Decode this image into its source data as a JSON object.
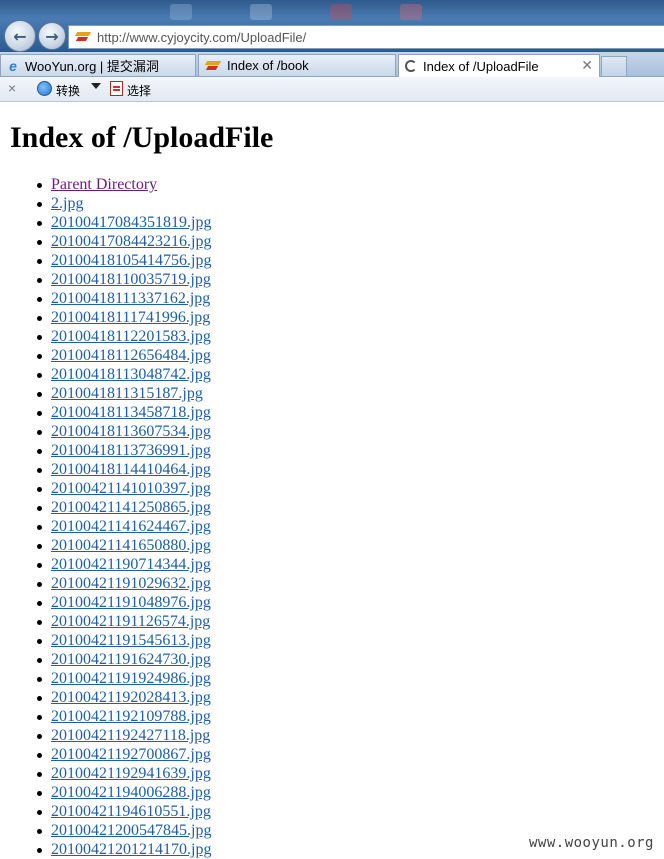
{
  "browser": {
    "address": "http://www.cyjoycity.com/UploadFile/",
    "tabs": [
      {
        "label": "WooYun.org | 提交漏洞",
        "icon": "ie-icon",
        "active": false
      },
      {
        "label": "Index of /book",
        "icon": "site-favicon",
        "active": false
      },
      {
        "label": "Index of /UploadFile",
        "icon": "refresh-icon",
        "active": true
      }
    ],
    "toolbar": {
      "close_symbol": "×",
      "convert_label": "转换",
      "select_label": "选择"
    }
  },
  "page": {
    "heading": "Index of /UploadFile",
    "entries": [
      "Parent Directory",
      "2.jpg",
      "20100417084351819.jpg",
      "20100417084423216.jpg",
      "20100418105414756.jpg",
      "20100418110035719.jpg",
      "20100418111337162.jpg",
      "20100418111741996.jpg",
      "20100418112201583.jpg",
      "20100418112656484.jpg",
      "20100418113048742.jpg",
      "2010041811315187.jpg",
      "20100418113458718.jpg",
      "20100418113607534.jpg",
      "20100418113736991.jpg",
      "20100418114410464.jpg",
      "20100421141010397.jpg",
      "20100421141250865.jpg",
      "20100421141624467.jpg",
      "20100421141650880.jpg",
      "20100421190714344.jpg",
      "20100421191029632.jpg",
      "20100421191048976.jpg",
      "20100421191126574.jpg",
      "20100421191545613.jpg",
      "20100421191624730.jpg",
      "20100421191924986.jpg",
      "20100421192028413.jpg",
      "20100421192109788.jpg",
      "20100421192427118.jpg",
      "20100421192700867.jpg",
      "20100421192941639.jpg",
      "20100421194006288.jpg",
      "20100421194610551.jpg",
      "20100421200547845.jpg",
      "20100421201214170.jpg"
    ]
  },
  "watermark": "www.wooyun.org",
  "colors": {
    "link": "#1f5eab",
    "visited_link": "#6b1d7a"
  }
}
